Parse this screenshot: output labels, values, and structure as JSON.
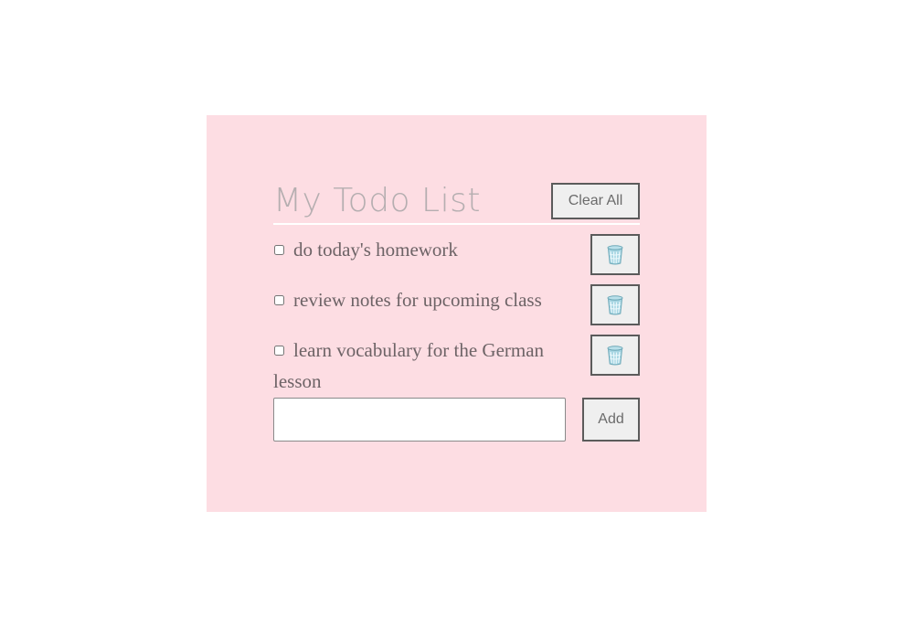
{
  "app": {
    "title": "My Todo List",
    "clear_label": "Clear All"
  },
  "todos": [
    {
      "text": "do today's homework",
      "checked": false,
      "delete_icon": "trash-icon"
    },
    {
      "text": "review notes for upcoming class",
      "checked": false,
      "delete_icon": "trash-icon"
    },
    {
      "text": "learn vocabulary for the German lesson",
      "checked": false,
      "delete_icon": "trash-icon"
    }
  ],
  "new_todo": {
    "value": "",
    "placeholder": ""
  },
  "add_label": "Add",
  "colors": {
    "card_background": "#fddde3",
    "title": "#b5aeb0",
    "item_text": "#6d6366",
    "button_background": "#efefef",
    "trash": "#8ec8d6"
  }
}
